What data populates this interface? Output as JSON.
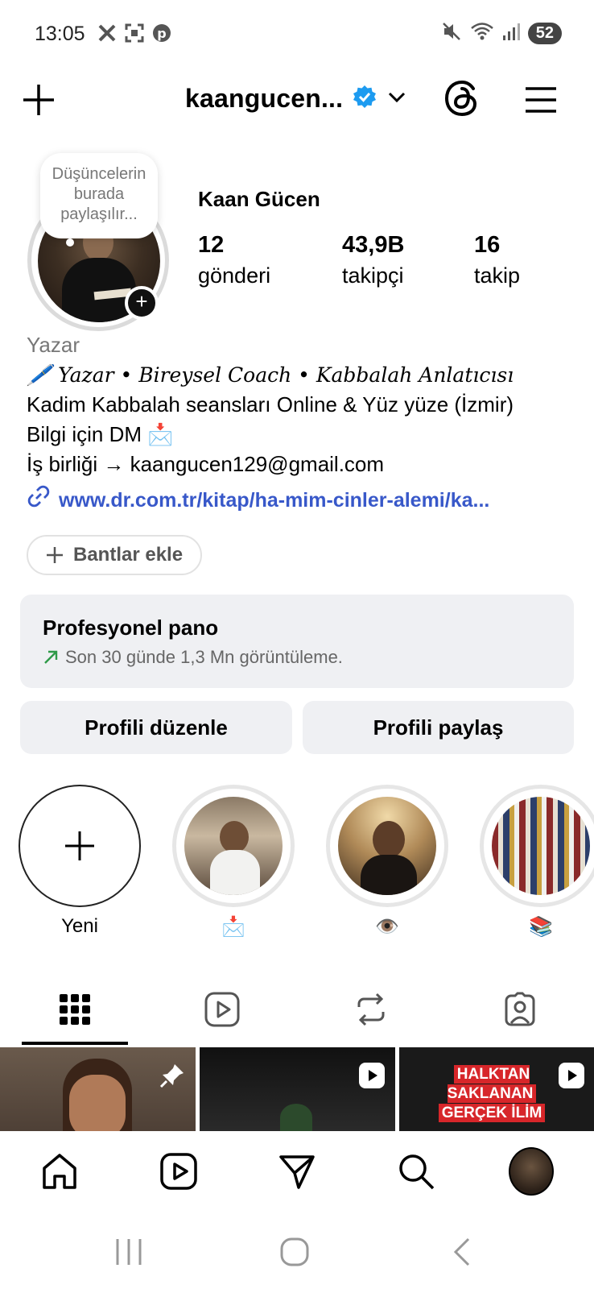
{
  "status_bar": {
    "time": "13:05",
    "battery": "52",
    "icons": [
      "x-app-icon",
      "screenshot-icon",
      "pinterest-icon",
      "mute-icon",
      "wifi-icon",
      "signal-icon"
    ]
  },
  "header": {
    "username": "kaangucen...",
    "verified": true,
    "colors": {
      "verified": "#1d9bf0",
      "link": "#3858c9"
    }
  },
  "profile": {
    "note": "Düşüncelerin burada paylaşılır...",
    "full_name": "Kaan Gücen",
    "stats": [
      {
        "value": "12",
        "label": "gönderi"
      },
      {
        "value": "43,9B",
        "label": "takipçi"
      },
      {
        "value": "16",
        "label": "takip"
      }
    ]
  },
  "bio": {
    "category": "Yazar",
    "line1": "🖊️ Yazar • Bireysel Coach • Kabbalah Anlatıcısı",
    "line2": "Kadim Kabbalah seansları Online & Yüz yüze (İzmir)",
    "line3": "Bilgi için DM 📩",
    "line4": "İş birliği → kaangucen129@gmail.com",
    "link": "www.dr.com.tr/kitap/ha-mim-cinler-alemi/ka..."
  },
  "bands_button": "Bantlar ekle",
  "professional_dashboard": {
    "title": "Profesyonel pano",
    "subtitle": "Son 30 günde 1,3 Mn görüntüleme."
  },
  "actions": {
    "edit": "Profili düzenle",
    "share": "Profili paylaş"
  },
  "highlights": [
    {
      "label": "Yeni"
    },
    {
      "label": "📩"
    },
    {
      "label": "👁️"
    },
    {
      "label": "📚"
    }
  ],
  "grid": {
    "post3_text_line1": "HALKTAN SAKLANAN",
    "post3_text_line2": "GERÇEK İLİM"
  }
}
